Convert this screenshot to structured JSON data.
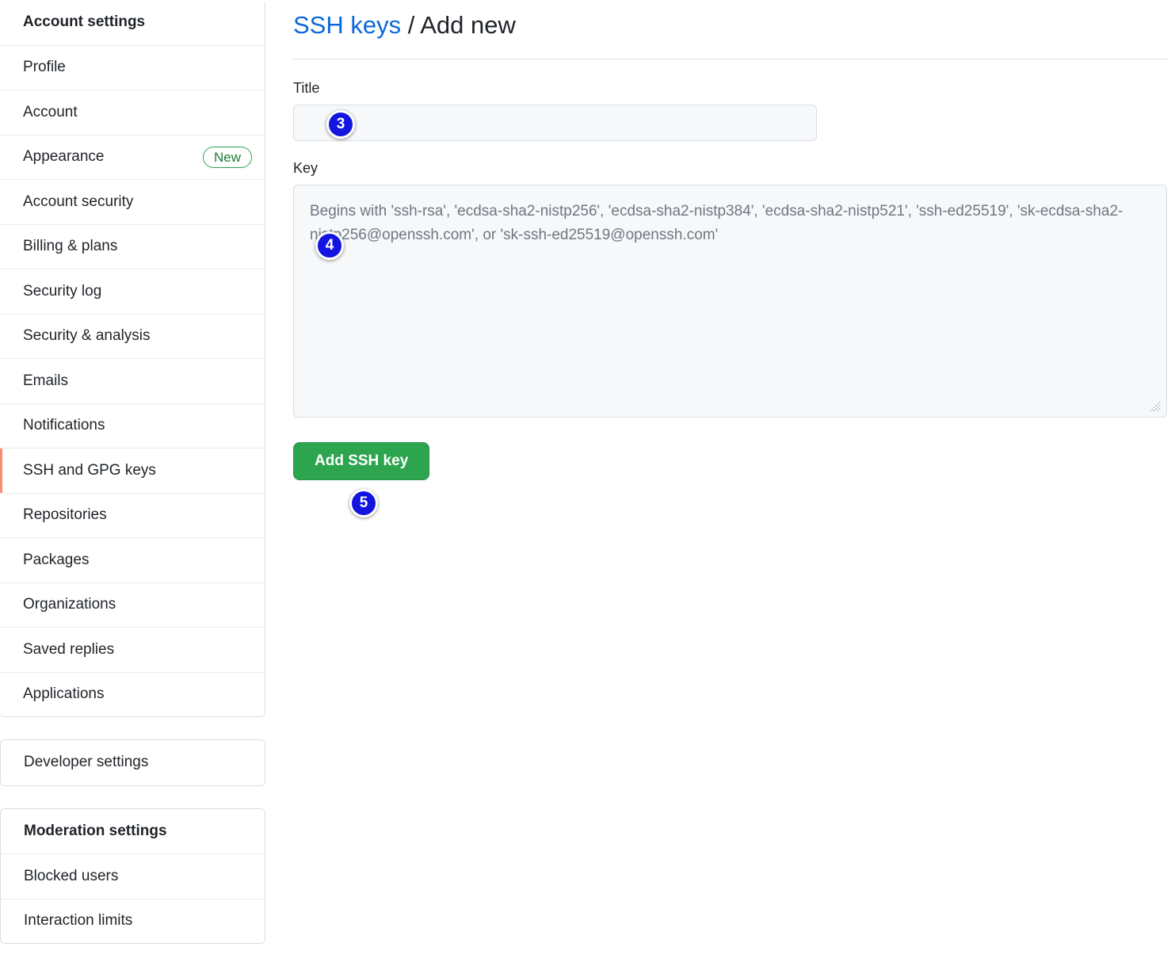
{
  "sidebar": {
    "groups": [
      {
        "name": "account-settings",
        "items": [
          {
            "label": "Account settings",
            "heading": true
          },
          {
            "label": "Profile"
          },
          {
            "label": "Account"
          },
          {
            "label": "Appearance",
            "badge": "New"
          },
          {
            "label": "Account security"
          },
          {
            "label": "Billing & plans"
          },
          {
            "label": "Security log"
          },
          {
            "label": "Security & analysis"
          },
          {
            "label": "Emails"
          },
          {
            "label": "Notifications"
          },
          {
            "label": "SSH and GPG keys",
            "active": true
          },
          {
            "label": "Repositories"
          },
          {
            "label": "Packages"
          },
          {
            "label": "Organizations"
          },
          {
            "label": "Saved replies"
          },
          {
            "label": "Applications"
          }
        ]
      },
      {
        "name": "developer-settings",
        "items": [
          {
            "label": "Developer settings"
          }
        ]
      },
      {
        "name": "moderation-settings",
        "items": [
          {
            "label": "Moderation settings",
            "heading": true
          },
          {
            "label": "Blocked users"
          },
          {
            "label": "Interaction limits"
          }
        ]
      }
    ]
  },
  "main": {
    "breadcrumb_link": "SSH keys",
    "breadcrumb_separator": " / ",
    "breadcrumb_current": "Add new",
    "title_field": {
      "label": "Title",
      "value": "",
      "placeholder": ""
    },
    "key_field": {
      "label": "Key",
      "value": "",
      "placeholder": "Begins with 'ssh-rsa', 'ecdsa-sha2-nistp256', 'ecdsa-sha2-nistp384', 'ecdsa-sha2-nistp521', 'ssh-ed25519', 'sk-ecdsa-sha2-nistp256@openssh.com', or 'sk-ssh-ed25519@openssh.com'"
    },
    "submit_label": "Add SSH key"
  },
  "markers": {
    "title_step": "3",
    "key_step": "4",
    "submit_step": "5"
  },
  "colors": {
    "link": "#0969da",
    "button_green": "#2da44e",
    "badge_new_green": "#1a7f37",
    "active_indicator": "#fd8c73",
    "marker_blue": "#1414e0"
  }
}
